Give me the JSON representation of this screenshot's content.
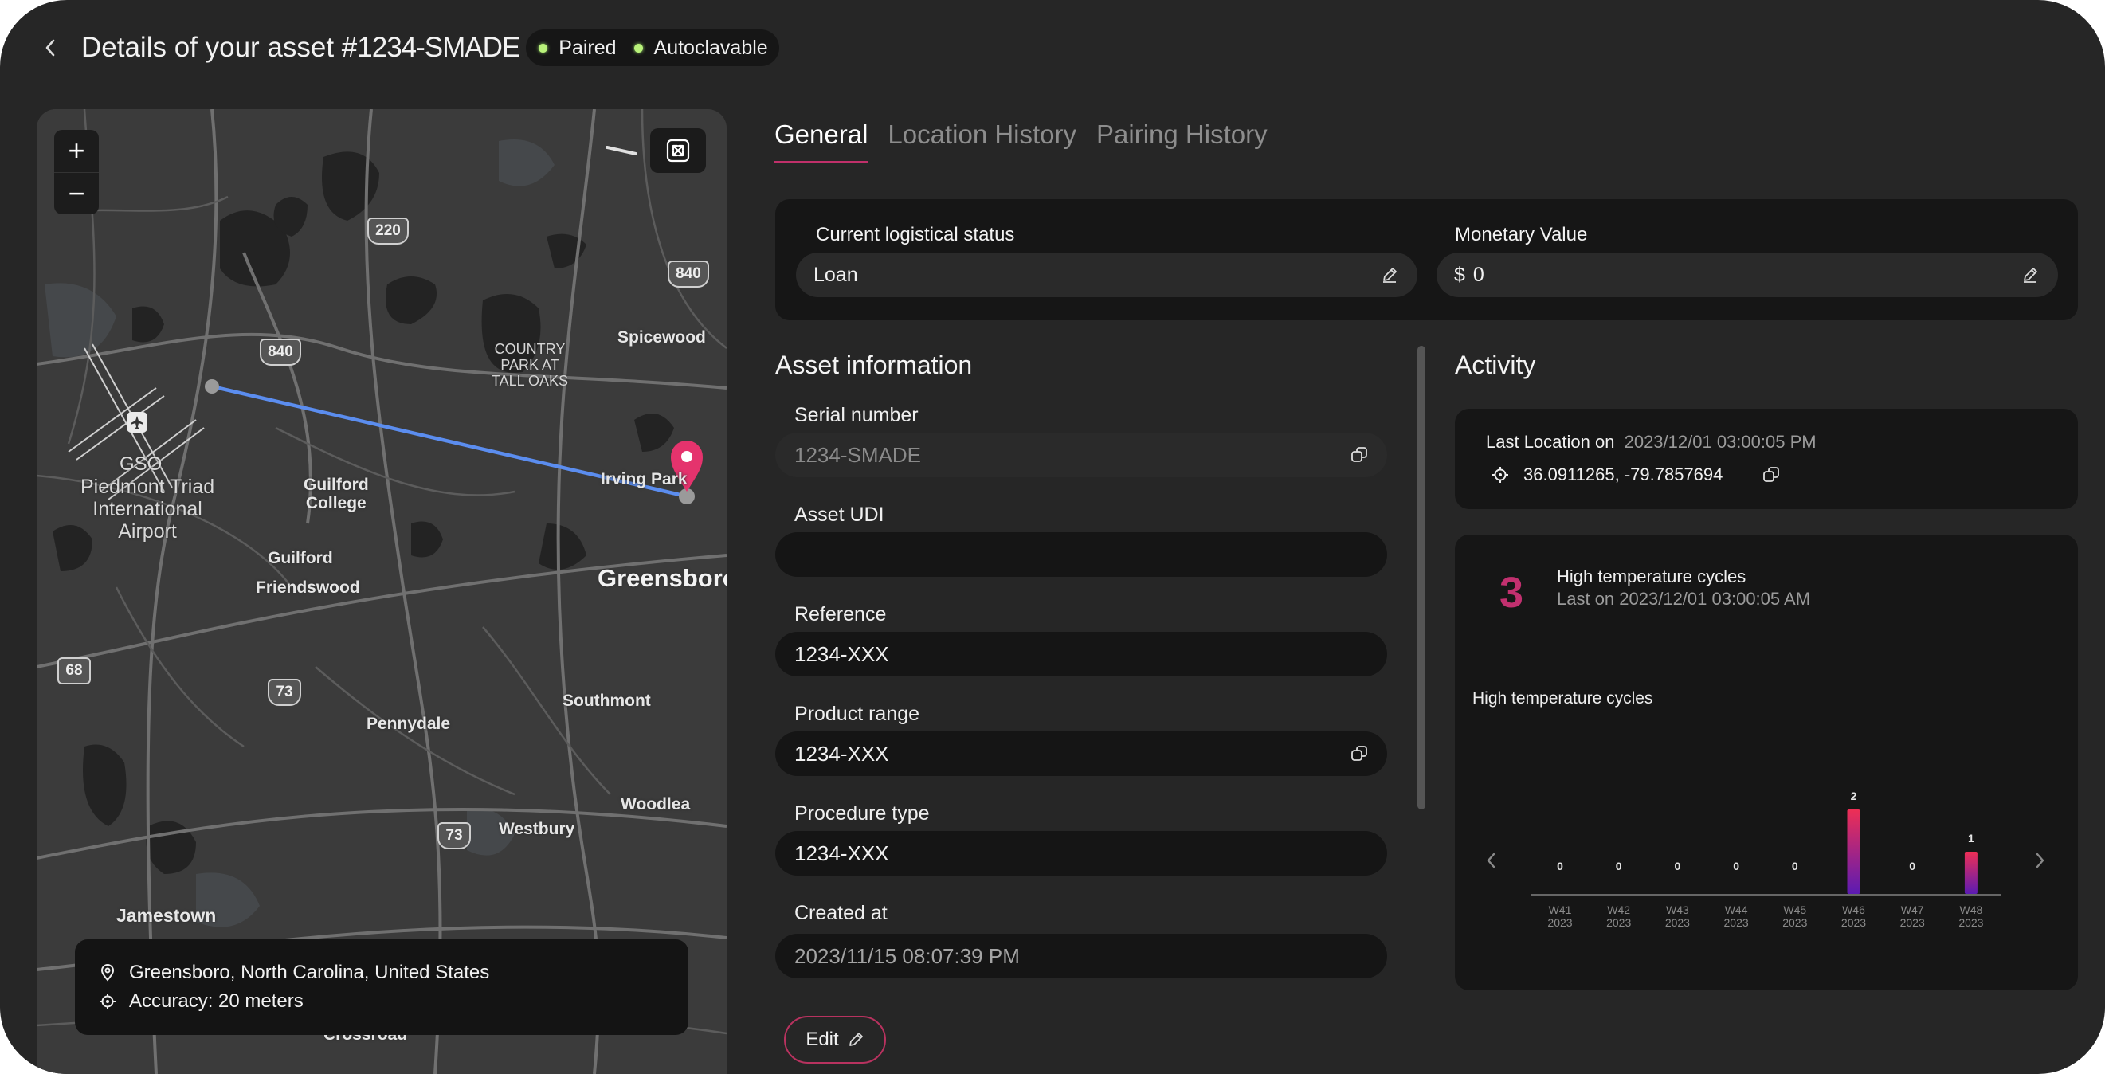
{
  "header": {
    "title": "Details of your asset #",
    "asset_id": "1234-SMADE",
    "badges": [
      {
        "label": "Paired",
        "color": "#b9f27a"
      },
      {
        "label": "Autoclavable",
        "color": "#b9f27a"
      }
    ]
  },
  "map": {
    "zoom_in": "+",
    "zoom_out": "−",
    "labels": {
      "spicewood": "Spicewood",
      "country_park": "COUNTRY\nPARK AT\nTALL OAKS",
      "airport_code": "GSO",
      "airport": "Piedmont Triad\nInternational\nAirport",
      "guilford_college": "Guilford\nCollege",
      "guilford": "Guilford",
      "friendswood": "Friendswood",
      "irving_park": "Irving Park",
      "greensboro": "Greensboro",
      "southmont": "Southmont",
      "pennydale": "Pennydale",
      "woodlea": "Woodlea",
      "westbury": "Westbury",
      "jamestown": "Jamestown",
      "crossroad": "Crossroad"
    },
    "shields": {
      "s220": "220",
      "s840a": "840",
      "s840b": "840",
      "s73a": "73",
      "s73b": "73",
      "s68": "68"
    },
    "location": "Greensboro, North Carolina, United States",
    "accuracy": "Accuracy: 20 meters"
  },
  "tabs": [
    {
      "label": "General",
      "active": true
    },
    {
      "label": "Location History",
      "active": false
    },
    {
      "label": "Pairing History",
      "active": false
    }
  ],
  "status_card": {
    "logistical_label": "Current logistical status",
    "logistical_value": "Loan",
    "monetary_label": "Monetary Value",
    "currency": "$",
    "monetary_value": "0"
  },
  "asset_info": {
    "title": "Asset information",
    "serial_label": "Serial number",
    "serial_value": "1234-SMADE",
    "udi_label": "Asset UDI",
    "udi_value": "",
    "reference_label": "Reference",
    "reference_value": "1234-XXX",
    "product_range_label": "Product range",
    "product_range_value": "1234-XXX",
    "procedure_label": "Procedure type",
    "procedure_value": "1234-XXX",
    "created_label": "Created at",
    "created_value": "2023/11/15 08:07:39 PM",
    "edit_label": "Edit"
  },
  "activity": {
    "title": "Activity",
    "last_location_label": "Last Location on",
    "last_location_date": "2023/12/01 03:00:05 PM",
    "coordinates": "36.0911265, -79.7857694",
    "count": "3",
    "count_title": "High temperature cycles",
    "count_sub": "Last on 2023/12/01 03:00:05 AM",
    "chart_title": "High temperature cycles"
  },
  "chart_data": {
    "type": "bar",
    "title": "High temperature cycles",
    "categories": [
      "W41 2023",
      "W42 2023",
      "W43 2023",
      "W44 2023",
      "W45 2023",
      "W46 2023",
      "W47 2023",
      "W48 2023"
    ],
    "week_labels": [
      "W41",
      "W42",
      "W43",
      "W44",
      "W45",
      "W46",
      "W47",
      "W48"
    ],
    "year_labels": [
      "2023",
      "2023",
      "2023",
      "2023",
      "2023",
      "2023",
      "2023",
      "2023"
    ],
    "values": [
      0,
      0,
      0,
      0,
      0,
      2,
      0,
      1
    ],
    "ylim": [
      0,
      2
    ],
    "bar_color_top": "#ee2f55",
    "bar_color_bottom": "#5b1bb3"
  },
  "colors": {
    "accent": "#c2306f",
    "route": "#5b8def",
    "pin": "#e5336d"
  }
}
